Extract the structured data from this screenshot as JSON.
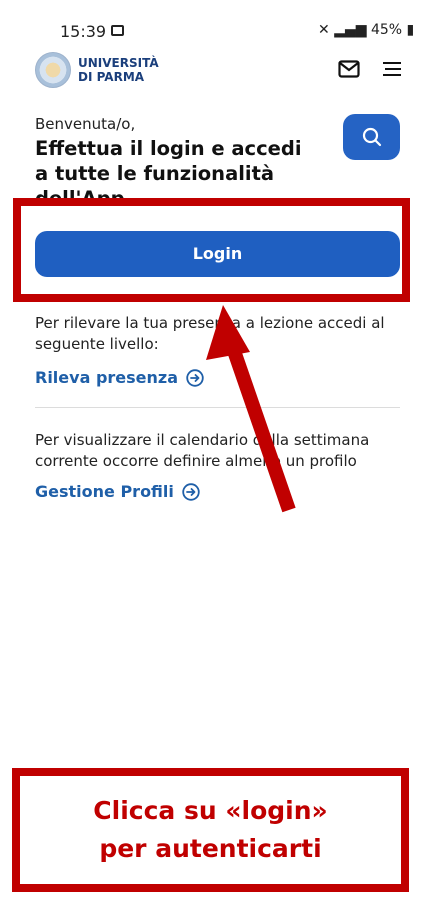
{
  "status_bar": {
    "time": "15:39",
    "indicators": "✖ ⇅ .❘ 45%",
    "battery": "45%"
  },
  "header": {
    "logo_line1": "UNIVERSITÀ",
    "logo_line2": "DI PARMA",
    "icons": [
      "logo-seal",
      "mail-icon",
      "menu-icon"
    ]
  },
  "hero": {
    "greeting": "Benvenuta/o,",
    "headline": "Effettua il login e accedi a tutte le funzionalità dell'App",
    "search_icon": "search-icon"
  },
  "login_button": "Login",
  "attendance": {
    "text": "Per rilevare la tua presenza a lezione accedi al seguente livello:",
    "link": "Rileva presenza"
  },
  "calendar": {
    "text": "Per visualizzare il calendario della settimana corrente occorre definire almeno un profilo",
    "link": "Gestione Profili"
  },
  "annotation": {
    "line1": "Clicca su «login»",
    "line2": "per autenticarti"
  },
  "colors": {
    "primary_blue": "#1f5fc1",
    "link_blue": "#1f5fa8",
    "annotation_red": "#c00000"
  }
}
